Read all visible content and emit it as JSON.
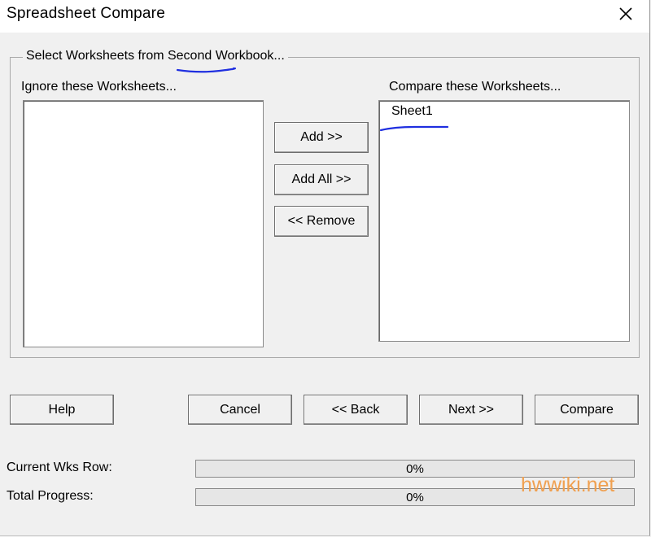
{
  "window": {
    "title": "Spreadsheet Compare"
  },
  "group": {
    "legend": "Select Worksheets from Second Workbook..."
  },
  "ignore_list": {
    "label": "Ignore these Worksheets...",
    "items": []
  },
  "compare_list": {
    "label": "Compare these Worksheets...",
    "items": [
      "Sheet1"
    ]
  },
  "middle_buttons": {
    "add": "Add >>",
    "add_all": "Add All >>",
    "remove": "<< Remove"
  },
  "bottom_buttons": {
    "help": "Help",
    "cancel": "Cancel",
    "back": "<< Back",
    "next": "Next >>",
    "compare": "Compare"
  },
  "progress": {
    "current_label": "Current Wks Row:",
    "current_value": "0%",
    "current_fraction": 0,
    "total_label": "Total Progress:",
    "total_value": "0%",
    "total_fraction": 0
  },
  "watermark": "hwwiki.net",
  "colors": {
    "annotation_pen": "#1f2fe0",
    "watermark": "#f0a050"
  }
}
